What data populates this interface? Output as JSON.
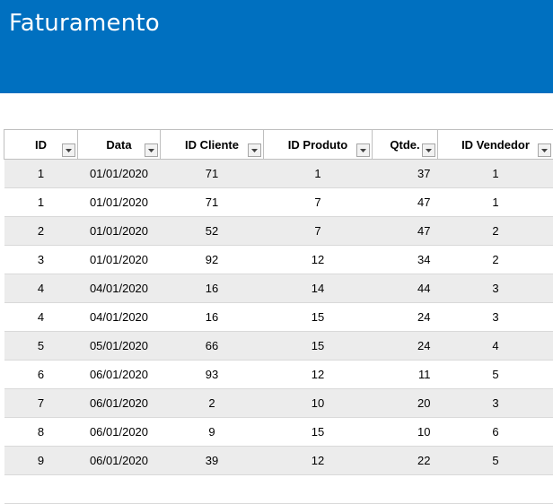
{
  "banner": {
    "title": "Faturamento",
    "color": "#0070c0"
  },
  "table": {
    "columns": [
      {
        "label": "ID",
        "filter_icon": "dropdown-filter-icon"
      },
      {
        "label": "Data",
        "filter_icon": "dropdown-filter-icon"
      },
      {
        "label": "ID Cliente",
        "filter_icon": "dropdown-filter-icon"
      },
      {
        "label": "ID Produto",
        "filter_icon": "dropdown-filter-icon"
      },
      {
        "label": "Qtde.",
        "filter_icon": "dropdown-filter-icon"
      },
      {
        "label": "ID Vendedor",
        "filter_icon": "dropdown-filter-icon"
      }
    ],
    "rows": [
      [
        "1",
        "01/01/2020",
        "71",
        "1",
        "37",
        "1"
      ],
      [
        "1",
        "01/01/2020",
        "71",
        "7",
        "47",
        "1"
      ],
      [
        "2",
        "01/01/2020",
        "52",
        "7",
        "47",
        "2"
      ],
      [
        "3",
        "01/01/2020",
        "92",
        "12",
        "34",
        "2"
      ],
      [
        "4",
        "04/01/2020",
        "16",
        "14",
        "44",
        "3"
      ],
      [
        "4",
        "04/01/2020",
        "16",
        "15",
        "24",
        "3"
      ],
      [
        "5",
        "05/01/2020",
        "66",
        "15",
        "24",
        "4"
      ],
      [
        "6",
        "06/01/2020",
        "93",
        "12",
        "11",
        "5"
      ],
      [
        "7",
        "06/01/2020",
        "2",
        "10",
        "20",
        "3"
      ],
      [
        "8",
        "06/01/2020",
        "9",
        "15",
        "10",
        "6"
      ],
      [
        "9",
        "06/01/2020",
        "39",
        "12",
        "22",
        "5"
      ],
      [
        "",
        "",
        "",
        "",
        "",
        ""
      ]
    ],
    "stripe_color": "#ececec"
  }
}
